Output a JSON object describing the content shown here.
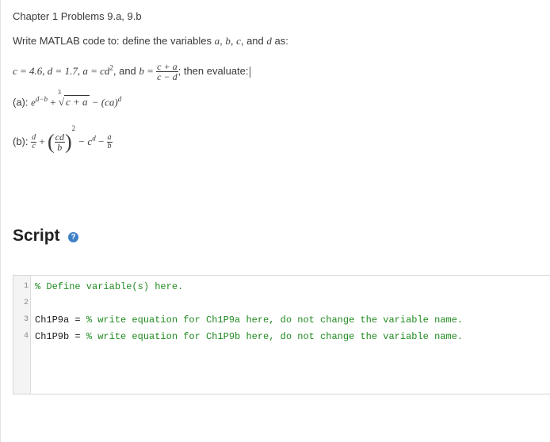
{
  "problem": {
    "title": "Chapter 1 Problems 9.a, 9.b",
    "instruction_prefix": "Write MATLAB code to: define the variables ",
    "var_a": "a",
    "sep1": ", ",
    "var_b": "b",
    "sep2": ", ",
    "var_c": "c",
    "sep3": ", and ",
    "var_d": "d",
    "instruction_suffix": " as:",
    "defs_lead": "c = 4.6,  d = 1.7,  a = cd",
    "defs_exp": "2",
    "defs_mid": ", and ",
    "defs_b": "b = ",
    "defs_frac_num": "c + a",
    "defs_frac_den": "c − d",
    "defs_tail": "; then evaluate:"
  },
  "equations": {
    "a_label": "(a): ",
    "a_base": "e",
    "a_exp": "d−b",
    "a_plus": " + ",
    "a_root_index": "3",
    "a_radicand": "c + a",
    "a_minus": " − (ca)",
    "a_minus_exp": "d",
    "b_label": "(b): ",
    "b_f1_num": "d",
    "b_f1_den": "c",
    "b_plus": " + ",
    "b_f2_num": "cd",
    "b_f2_den": "b",
    "b_f2_exp": "2",
    "b_minus1": " − c",
    "b_minus1_exp": "d",
    "b_minus2": " − ",
    "b_f3_num": "a",
    "b_f3_den": "b"
  },
  "script": {
    "title": "Script",
    "help_icon": "?"
  },
  "editor": {
    "lines": [
      {
        "num": "1",
        "ident": "",
        "comment": "% Define variable(s) here."
      },
      {
        "num": "2",
        "ident": "",
        "comment": ""
      },
      {
        "num": "3",
        "ident": "Ch1P9a = ",
        "comment": "% write equation for Ch1P9a here, do not change the variable name."
      },
      {
        "num": "4",
        "ident": "Ch1P9b = ",
        "comment": "% write equation for Ch1P9b here, do not change the variable name."
      }
    ]
  }
}
